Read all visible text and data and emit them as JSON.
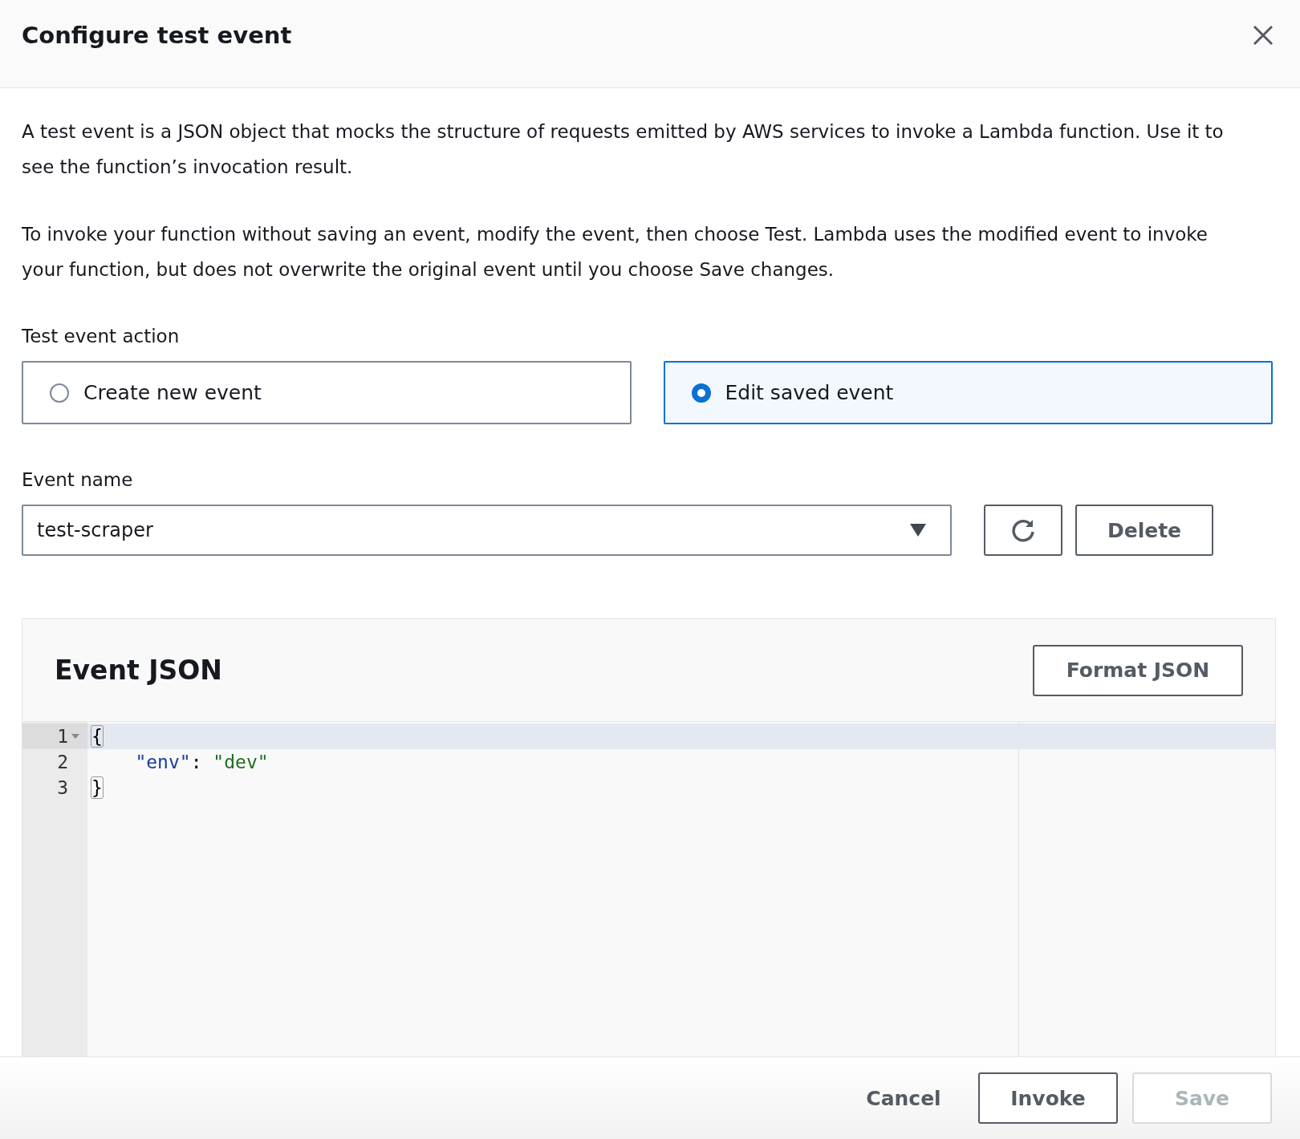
{
  "dialog": {
    "title": "Configure test event"
  },
  "intro": [
    "A test event is a JSON object that mocks the structure of requests emitted by AWS services to invoke a Lambda function. Use it to see the function’s invocation result.",
    "To invoke your function without saving an event, modify the event, then choose Test. Lambda uses the modified event to invoke your function, but does not overwrite the original event until you choose Save changes."
  ],
  "test_event_action": {
    "label": "Test event action",
    "options": [
      {
        "label": "Create new event",
        "selected": false
      },
      {
        "label": "Edit saved event",
        "selected": true
      }
    ]
  },
  "event_name": {
    "label": "Event name",
    "value": "test-scraper",
    "delete_button": "Delete"
  },
  "editor": {
    "title": "Event JSON",
    "format_button": "Format JSON",
    "lines": [
      {
        "number": "1",
        "active": true,
        "foldable": true,
        "tokens": [
          {
            "kind": "brace",
            "text": "{"
          }
        ]
      },
      {
        "number": "2",
        "active": false,
        "foldable": false,
        "tokens": [
          {
            "kind": "key",
            "text": "\"env\""
          },
          {
            "kind": "punct",
            "text": ":"
          },
          {
            "kind": "string",
            "text": "\"dev\""
          }
        ]
      },
      {
        "number": "3",
        "active": false,
        "foldable": false,
        "tokens": [
          {
            "kind": "brace",
            "text": "}"
          }
        ]
      }
    ]
  },
  "footer": {
    "buttons": [
      {
        "label": "Cancel",
        "kind": "link",
        "disabled": false
      },
      {
        "label": "Invoke",
        "kind": "normal",
        "disabled": false
      },
      {
        "label": "Save",
        "kind": "normal",
        "disabled": true
      }
    ]
  }
}
